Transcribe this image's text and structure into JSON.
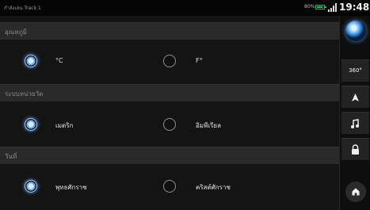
{
  "status": {
    "title": "กำลังเล่น Track 1",
    "battery": "80%",
    "time": "19:48"
  },
  "sections": {
    "temperature": {
      "header": "อุณหภูมิ",
      "options": [
        "°C",
        "F°"
      ],
      "selected": 0
    },
    "units": {
      "header": "ระบบหน่วยวัด",
      "options": [
        "เมตริก",
        "อิมพีเรียล"
      ],
      "selected": 0
    },
    "date": {
      "header": "วันที่",
      "options": [
        "พุทธศักราช",
        "คริสต์ศักราช"
      ],
      "selected": 0
    }
  },
  "sidebar": {
    "view360_label": "360°",
    "icons": [
      "blue-orb-icon",
      "360-view-icon",
      "navigation-arrow-icon",
      "music-note-icon",
      "lock-icon",
      "home-icon"
    ]
  },
  "colors": {
    "accent": "#8cc4ff",
    "background": "#141414",
    "header_bg": "#2a2a2a"
  }
}
